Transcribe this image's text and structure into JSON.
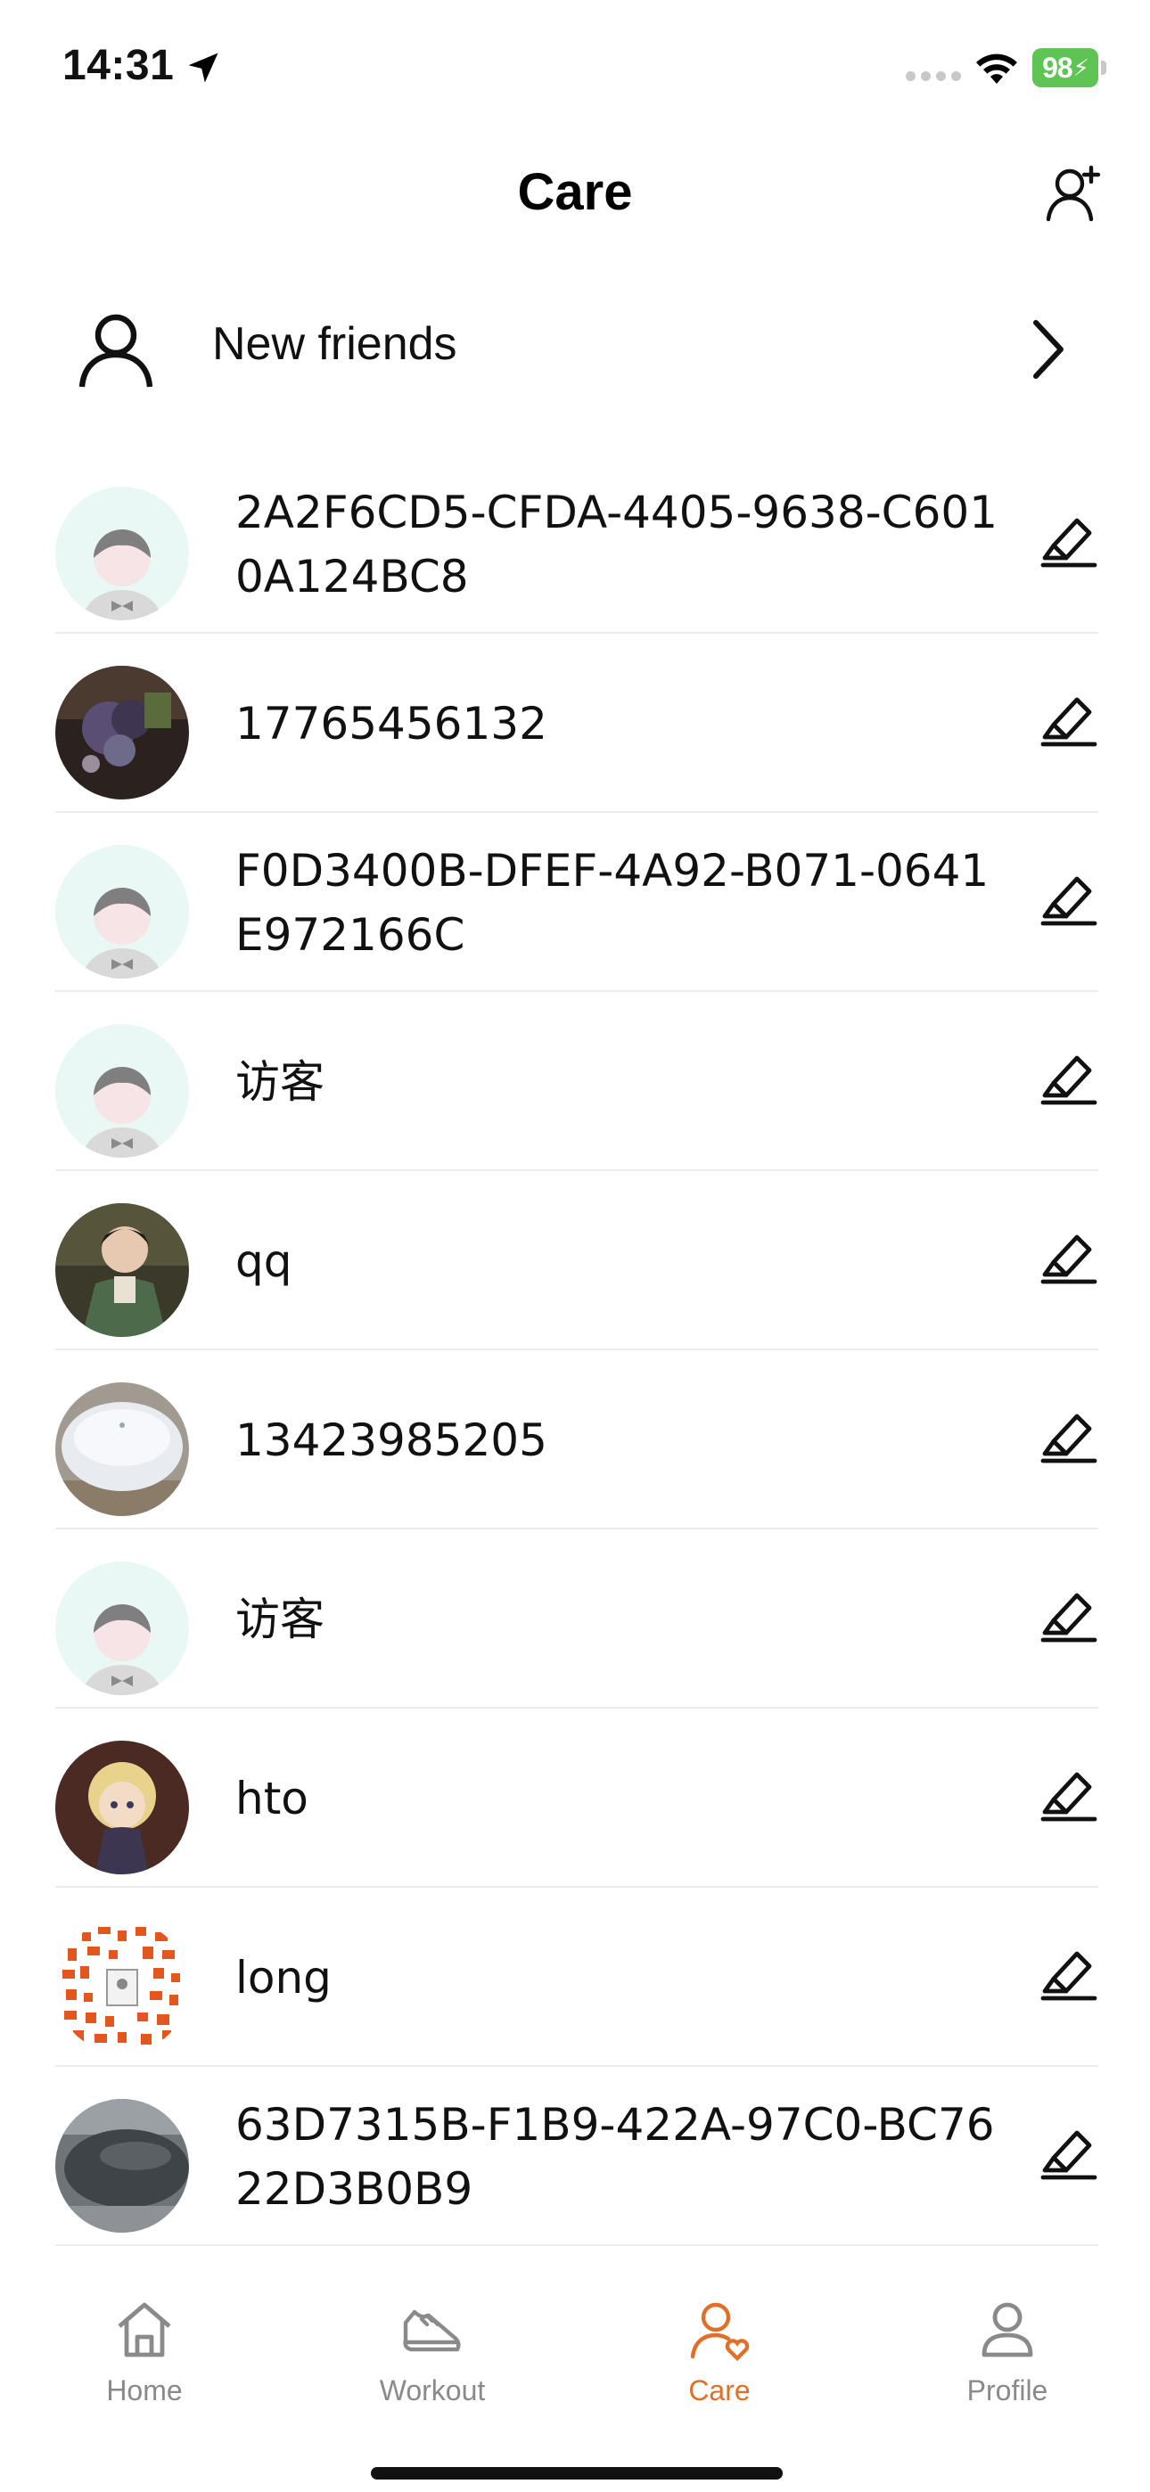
{
  "status_bar": {
    "time": "14:31",
    "battery": "98",
    "battery_color": "#5ec453"
  },
  "header": {
    "title": "Care",
    "add_friend_icon": "add-user-icon"
  },
  "new_friends": {
    "label": "New friends",
    "icon": "person-icon",
    "chevron_icon": "chevron-right-icon"
  },
  "contacts": [
    {
      "name": "2A2F6CD5-CFDA-4405-9638-C6010A124BC8",
      "avatar": "default"
    },
    {
      "name": "17765456132",
      "avatar": "photo-flowers"
    },
    {
      "name": "F0D3400B-DFEF-4A92-B071-0641E972166C",
      "avatar": "default"
    },
    {
      "name": "访客",
      "avatar": "default"
    },
    {
      "name": "qq",
      "avatar": "photo-anime"
    },
    {
      "name": "13423985205",
      "avatar": "photo-earbuds"
    },
    {
      "name": "访客",
      "avatar": "default"
    },
    {
      "name": "hto",
      "avatar": "photo-plush"
    },
    {
      "name": "long",
      "avatar": "photo-qr"
    },
    {
      "name": "63D7315B-F1B9-422A-97C0-BC7622D3B0B9",
      "avatar": "photo-gray"
    }
  ],
  "tabs": [
    {
      "label": "Home",
      "icon": "home-icon",
      "active": false
    },
    {
      "label": "Workout",
      "icon": "shoe-icon",
      "active": false
    },
    {
      "label": "Care",
      "icon": "care-icon",
      "active": true
    },
    {
      "label": "Profile",
      "icon": "profile-icon",
      "active": false
    }
  ],
  "colors": {
    "accent": "#e06f27",
    "inactive": "#8a8a8a",
    "divider": "#ececec"
  }
}
